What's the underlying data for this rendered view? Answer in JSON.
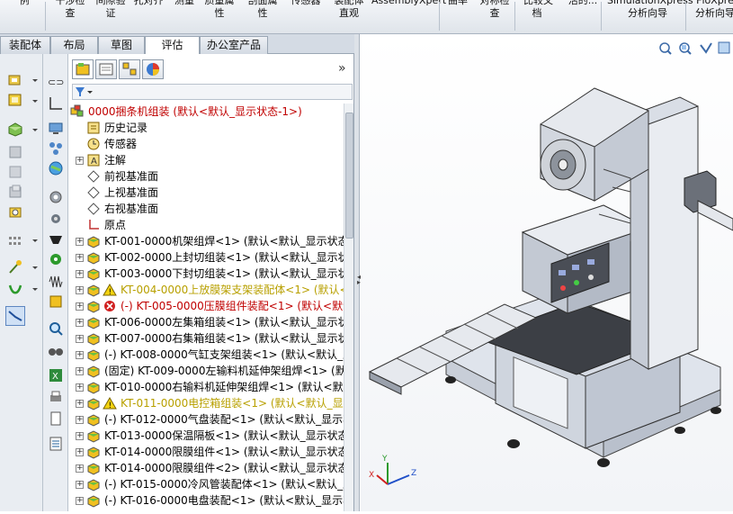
{
  "ribbon": {
    "buttons": [
      {
        "line1": "例",
        "line2": ""
      },
      {
        "line1": "干涉检",
        "line2": "查"
      },
      {
        "line1": "间隙验",
        "line2": "证"
      },
      {
        "line1": "孔对齐",
        "line2": ""
      },
      {
        "line1": "测量",
        "line2": ""
      },
      {
        "line1": "质量属",
        "line2": "性"
      },
      {
        "line1": "剖面属",
        "line2": "性"
      },
      {
        "line1": "传感器",
        "line2": ""
      },
      {
        "line1": "装配体",
        "line2": "直观"
      },
      {
        "line1": "AssemblyXpert",
        "line2": ""
      },
      {
        "line1": "曲率",
        "line2": ""
      },
      {
        "line1": "对称检",
        "line2": "查"
      },
      {
        "line1": "比较文",
        "line2": "档"
      },
      {
        "line1": "活的...",
        "line2": ""
      },
      {
        "line1": "SimulationXpress",
        "line2": "分析向导"
      },
      {
        "line1": "FloXpre",
        "line2": "分析向导"
      }
    ]
  },
  "tabs": [
    {
      "label": "装配体",
      "active": false
    },
    {
      "label": "布局",
      "active": false
    },
    {
      "label": "草图",
      "active": false
    },
    {
      "label": "评估",
      "active": true
    },
    {
      "label": "办公室产品",
      "active": false
    }
  ],
  "feature_manager": {
    "more_label": "»",
    "tree": [
      {
        "label": "0000捆条机组装  (默认<默认_显示状态-1>)",
        "color": "#c00000",
        "icon": "assembly-root-icon",
        "indent": 0,
        "expander": ""
      },
      {
        "label": "历史记录",
        "color": "#000000",
        "icon": "history-icon",
        "indent": 1,
        "expander": ""
      },
      {
        "label": "传感器",
        "color": "#000000",
        "icon": "sensor-icon",
        "indent": 1,
        "expander": ""
      },
      {
        "label": "注解",
        "color": "#000000",
        "icon": "annotation-icon",
        "indent": 1,
        "expander": "+"
      },
      {
        "label": "前视基准面",
        "color": "#000000",
        "icon": "plane-icon",
        "indent": 1,
        "expander": ""
      },
      {
        "label": "上视基准面",
        "color": "#000000",
        "icon": "plane-icon",
        "indent": 1,
        "expander": ""
      },
      {
        "label": "右视基准面",
        "color": "#000000",
        "icon": "plane-icon",
        "indent": 1,
        "expander": ""
      },
      {
        "label": "原点",
        "color": "#000000",
        "icon": "origin-icon",
        "indent": 1,
        "expander": ""
      },
      {
        "label": "KT-001-0000机架组焊<1> (默认<默认_显示状态",
        "color": "#000000",
        "icon": "subassembly-icon",
        "indent": 1,
        "expander": "+"
      },
      {
        "label": "KT-002-0000上封切组装<1> (默认<默认_显示状",
        "color": "#000000",
        "icon": "subassembly-icon",
        "indent": 1,
        "expander": "+"
      },
      {
        "label": "KT-003-0000下封切组装<1> (默认<默认_显示状",
        "color": "#000000",
        "icon": "subassembly-icon",
        "indent": 1,
        "expander": "+"
      },
      {
        "label": "KT-004-0000上放膜架支架装配体<1> (默认<",
        "color": "#b8a000",
        "icon": "warning-icon",
        "indent": 1,
        "expander": "+"
      },
      {
        "label": "(-) KT-005-0000压膜组件装配<1> (默认<默认",
        "color": "#c00000",
        "icon": "error-icon",
        "indent": 1,
        "expander": "+"
      },
      {
        "label": "KT-006-0000左集箱组装<1> (默认<默认_显示状",
        "color": "#000000",
        "icon": "subassembly-icon",
        "indent": 1,
        "expander": "+"
      },
      {
        "label": "KT-007-0000右集箱组装<1> (默认<默认_显示状",
        "color": "#000000",
        "icon": "subassembly-icon",
        "indent": 1,
        "expander": "+"
      },
      {
        "label": "(-) KT-008-0000气缸支架组装<1> (默认<默认_显",
        "color": "#000000",
        "icon": "subassembly-icon",
        "indent": 1,
        "expander": "+"
      },
      {
        "label": "(固定) KT-009-0000左输料机延伸架组焊<1> (默认",
        "color": "#000000",
        "icon": "subassembly-icon",
        "indent": 1,
        "expander": "+"
      },
      {
        "label": "KT-010-0000右输料机延伸架组焊<1> (默认<默认",
        "color": "#000000",
        "icon": "subassembly-icon",
        "indent": 1,
        "expander": "+"
      },
      {
        "label": "KT-011-0000电控箱组装<1> (默认<默认_显示",
        "color": "#b8a000",
        "icon": "warning-icon",
        "indent": 1,
        "expander": "+"
      },
      {
        "label": "(-) KT-012-0000气盘装配<1> (默认<默认_显示状",
        "color": "#000000",
        "icon": "subassembly-icon",
        "indent": 1,
        "expander": "+"
      },
      {
        "label": "KT-013-0000保温隔板<1> (默认<默认_显示状态",
        "color": "#000000",
        "icon": "subassembly-icon",
        "indent": 1,
        "expander": "+"
      },
      {
        "label": "KT-014-0000限膜组件<1> (默认<默认_显示状态",
        "color": "#000000",
        "icon": "subassembly-icon",
        "indent": 1,
        "expander": "+"
      },
      {
        "label": "KT-014-0000限膜组件<2> (默认<默认_显示状态",
        "color": "#000000",
        "icon": "subassembly-icon",
        "indent": 1,
        "expander": "+"
      },
      {
        "label": "(-) KT-015-0000冷风管装配体<1> (默认<默认_显",
        "color": "#000000",
        "icon": "subassembly-icon",
        "indent": 1,
        "expander": "+"
      },
      {
        "label": "(-) KT-016-0000电盘装配<1> (默认<默认_显示状",
        "color": "#000000",
        "icon": "subassembly-icon",
        "indent": 1,
        "expander": "+"
      }
    ]
  },
  "graphics": {
    "triad": {
      "x": "X",
      "y": "Y",
      "z": "Z"
    }
  },
  "colors": {
    "error": "#c00000",
    "warning": "#b8a000",
    "accent": "#2a5d9f"
  }
}
